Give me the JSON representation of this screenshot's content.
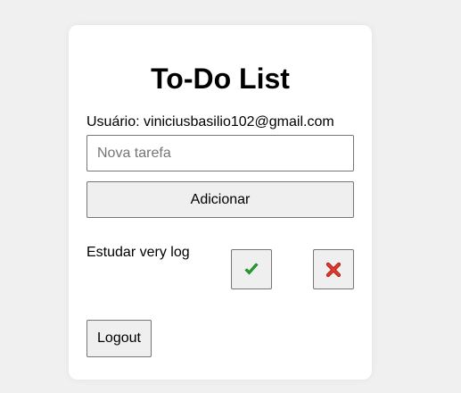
{
  "header": {
    "title": "To-Do List"
  },
  "user": {
    "label": "Usuário: viniciusbasilio102@gmail.com"
  },
  "new_task": {
    "placeholder": "Nova tarefa",
    "value": ""
  },
  "actions": {
    "add_label": "Adicionar",
    "logout_label": "Logout"
  },
  "tasks": [
    {
      "text": "Estudar very log",
      "complete_icon": "check-icon",
      "delete_icon": "delete-x-icon"
    }
  ],
  "colors": {
    "background": "#f0f0f0",
    "card": "#ffffff",
    "check": "#22a32a",
    "delete": "#d8281f"
  }
}
